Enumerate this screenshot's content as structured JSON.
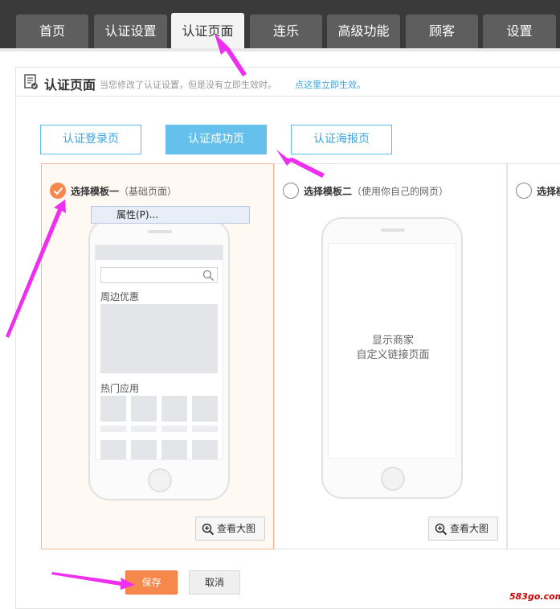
{
  "nav": {
    "tabs": [
      {
        "label": "首页"
      },
      {
        "label": "认证设置"
      },
      {
        "label": "认证页面"
      },
      {
        "label": "连乐"
      },
      {
        "label": "高级功能"
      },
      {
        "label": "顾客"
      },
      {
        "label": "设置"
      }
    ],
    "active_tab": "认证页面"
  },
  "header": {
    "title": "认证页面",
    "note": "当您修改了认证设置，但是没有立即生效时。",
    "link": "点这里立即生效。"
  },
  "subtabs": [
    {
      "label": "认证登录页"
    },
    {
      "label": "认证成功页"
    },
    {
      "label": "认证海报页"
    }
  ],
  "active_subtab": "认证成功页",
  "templates": [
    {
      "label": "选择模板一",
      "sublabel": "（基础页面）",
      "selected": true,
      "preview": {
        "section1": "周边优惠",
        "section2": "热门应用"
      },
      "zoom_label": "查看大图"
    },
    {
      "label": "选择模板二",
      "sublabel": "（使用你自己的网页）",
      "selected": false,
      "preview": {
        "line1": "显示商家",
        "line2": "自定义链接页面"
      },
      "zoom_label": "查看大图"
    },
    {
      "label": "选择模",
      "selected": false
    }
  ],
  "context_menu": {
    "item": "属性(P)..."
  },
  "actions": {
    "save": "保存",
    "cancel": "取消"
  },
  "watermark": "583go.com",
  "colors": {
    "accent_orange": "#f5894d",
    "accent_blue": "#65c1ec",
    "annotation_arrow": "#ee2ff0",
    "nav_bg": "#3a3a3a"
  }
}
